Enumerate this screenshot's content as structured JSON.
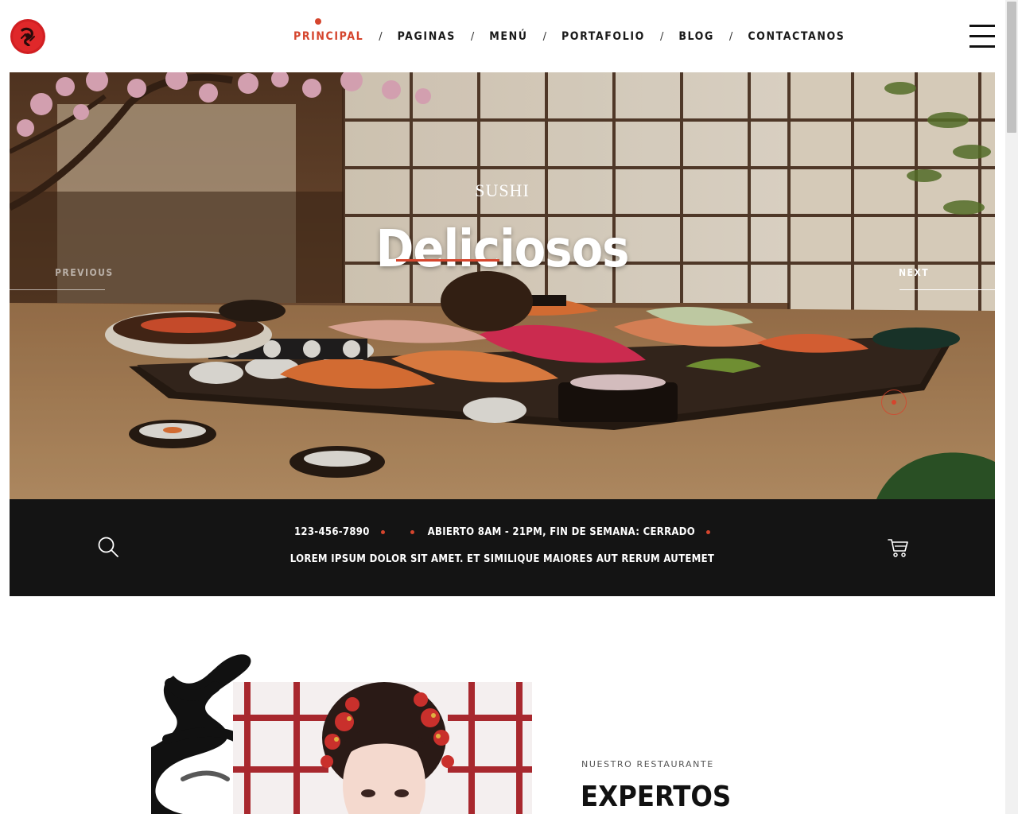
{
  "header": {
    "logo_icon": "sushi-logo-icon",
    "nav": [
      {
        "label": "PRINCIPAL",
        "active": true
      },
      {
        "label": "PAGINAS",
        "active": false
      },
      {
        "label": "MENÚ",
        "active": false
      },
      {
        "label": "PORTAFOLIO",
        "active": false
      },
      {
        "label": "BLOG",
        "active": false
      },
      {
        "label": "CONTACTANOS",
        "active": false
      }
    ],
    "separator": "/",
    "menu_icon": "hamburger-menu-icon",
    "accent_color": "#d5452d"
  },
  "hero": {
    "kicker": "SUSHI",
    "title": "Deliciosos",
    "prev_label": "PREVIOUS",
    "next_label": "NEXT",
    "slider_dot_icon": "slider-dot-icon"
  },
  "infobar": {
    "phone": "123-456-7890",
    "hours": "ABIERTO 8AM - 21PM, FIN DE SEMANA: CERRADO",
    "tagline": "LOREM IPSUM DOLOR SIT AMET. ET SIMILIQUE MAIORES AUT RERUM AUTEMET",
    "search_icon": "search-icon",
    "cart_icon": "cart-icon",
    "background": "#141414"
  },
  "about": {
    "kicker": "NUESTRO RESTAURANTE",
    "title": "EXPERTOS"
  }
}
